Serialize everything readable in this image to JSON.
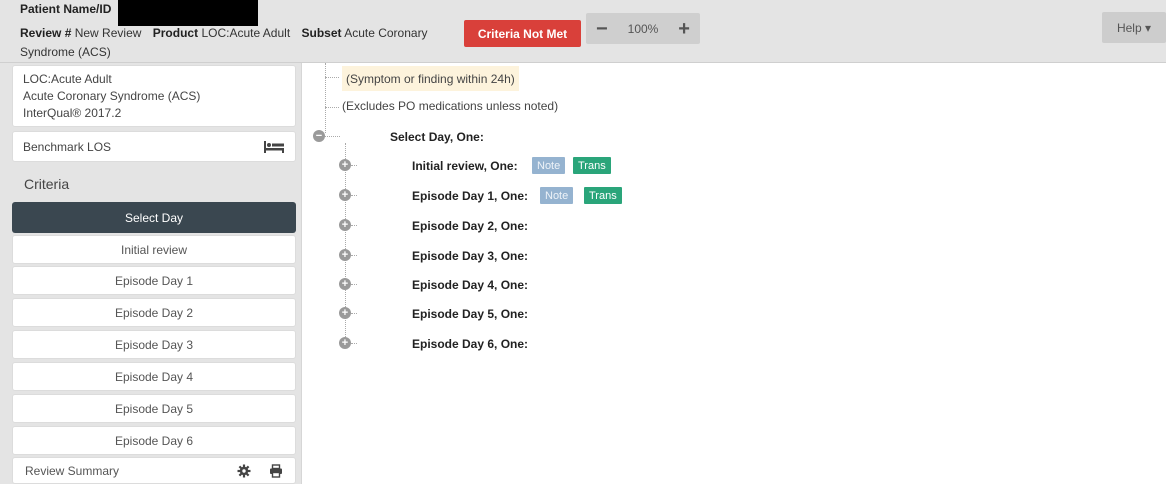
{
  "header": {
    "patient_label": "Patient Name/ID",
    "review_label": "Review #",
    "review_value": "New Review",
    "product_label": "Product",
    "product_value": "LOC:Acute Adult",
    "subset_label": "Subset",
    "subset_value_line1": "Acute Coronary",
    "subset_value_line2": "Syndrome (ACS)",
    "criteria_status": "Criteria Not Met",
    "zoom_value": "100%",
    "zoom_out_label": "−",
    "zoom_in_label": "+",
    "help_label": "Help ▾",
    "status_color": "#d9403a"
  },
  "sidebar": {
    "info_line1": "LOC:Acute Adult",
    "info_line2": "Acute Coronary Syndrome (ACS)",
    "info_line3": "InterQual® 2017.2",
    "benchmark_label": "Benchmark LOS",
    "benchmark_icon": "bed-icon",
    "criteria_heading": "Criteria",
    "selected_item": "Select Day",
    "items": [
      "Initial review",
      "Episode Day 1",
      "Episode Day 2",
      "Episode Day 3",
      "Episode Day 4",
      "Episode Day 5",
      "Episode Day 6"
    ],
    "summary_label": "Review Summary",
    "summary_icons": [
      "gear-icon",
      "print-icon"
    ],
    "selected_color": "#3a4750"
  },
  "tree": {
    "note_symptom": "(Symptom or finding within 24h)",
    "note_excludes": "(Excludes PO medications unless noted)",
    "root_label": "Select Day, One:",
    "root_toggle": "−",
    "child_toggle": "+",
    "children": [
      {
        "label": "Initial review, One:",
        "note": "Note",
        "trans": "Trans"
      },
      {
        "label": "Episode Day 1, One:",
        "note": "Note",
        "trans": "Trans"
      },
      {
        "label": "Episode Day 2, One:"
      },
      {
        "label": "Episode Day 3, One:"
      },
      {
        "label": "Episode Day 4, One:"
      },
      {
        "label": "Episode Day 5, One:"
      },
      {
        "label": "Episode Day 6, One:"
      }
    ],
    "note_tag_color": "#95b3d0",
    "trans_tag_color": "#2aa57a"
  }
}
